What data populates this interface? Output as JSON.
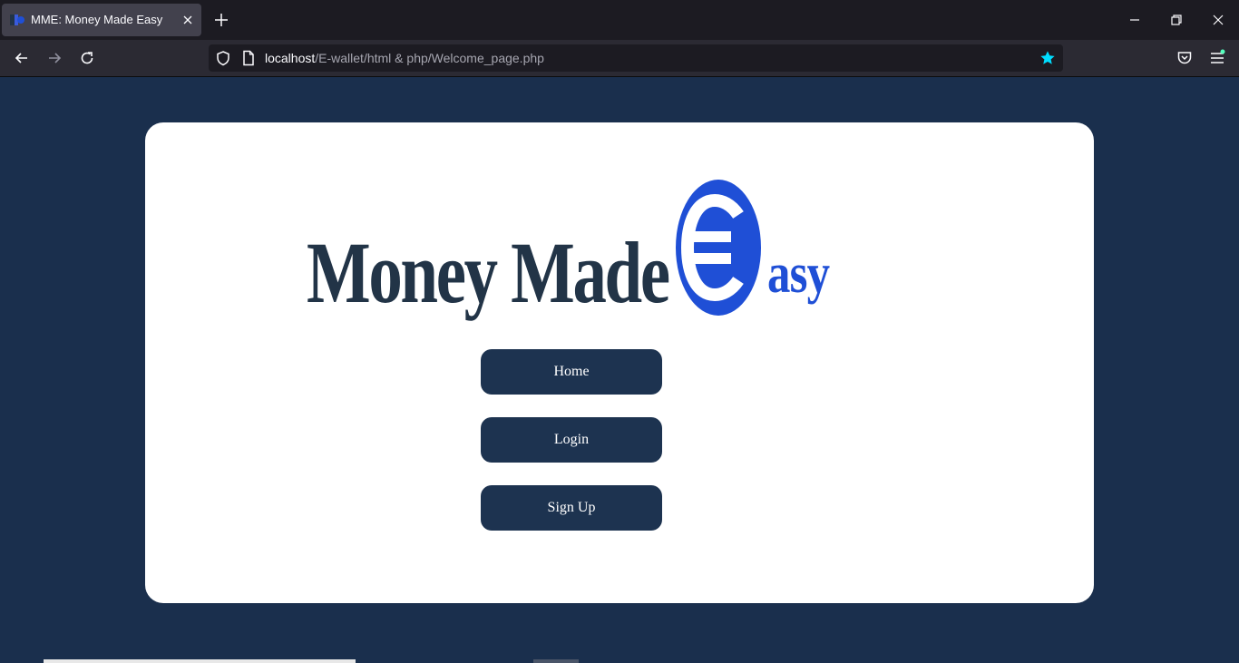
{
  "browser": {
    "tab": {
      "title": "MME: Money Made Easy",
      "favicon": "mme-logo-icon"
    },
    "url": {
      "host": "localhost",
      "path": "/E-wallet/html & php/Welcome_page.php"
    },
    "icons": {
      "back": "arrow-left-icon",
      "forward": "arrow-right-icon",
      "reload": "reload-icon",
      "shield": "shield-icon",
      "page": "page-icon",
      "bookmark": "star-icon",
      "pocket": "pocket-icon",
      "menu": "hamburger-icon"
    },
    "colors": {
      "bookmark_star": "#00ddff"
    }
  },
  "page": {
    "logo": {
      "text": "Money Made",
      "suffix": "asy",
      "emblem": "euro-icon"
    },
    "buttons": {
      "home": "Home",
      "login": "Login",
      "signup": "Sign Up"
    },
    "colors": {
      "background": "#1a2f4d",
      "card": "#ffffff",
      "button": "#1d3350",
      "logo_blue": "#1f4fd6",
      "logo_dark": "#223447"
    }
  }
}
